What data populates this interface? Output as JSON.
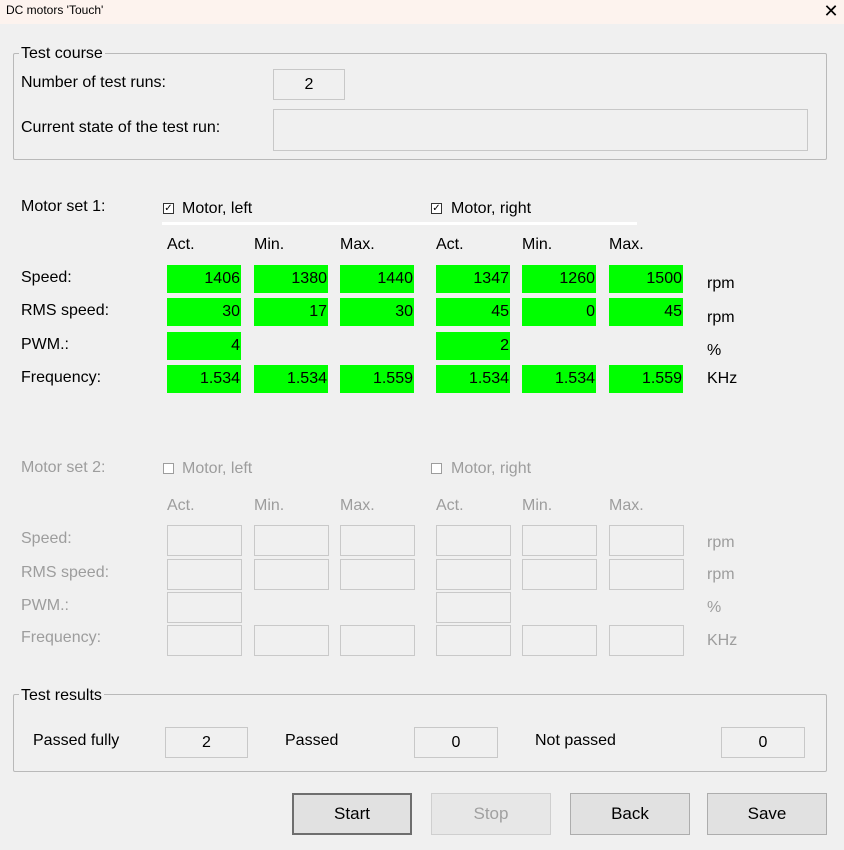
{
  "window": {
    "title": "DC motors 'Touch'"
  },
  "test_course": {
    "legend": "Test course",
    "num_runs_label": "Number of test runs:",
    "num_runs_value": "2",
    "state_label": "Current state of the test run:",
    "state_value": ""
  },
  "column_headers": [
    "Act.",
    "Min.",
    "Max.",
    "Act.",
    "Min.",
    "Max."
  ],
  "row_labels": [
    "Speed:",
    "RMS speed:",
    "PWM.:",
    "Frequency:"
  ],
  "units": [
    "rpm",
    "rpm",
    "%",
    "KHz"
  ],
  "motor_set_1": {
    "label": "Motor set 1:",
    "left_checkbox": {
      "label": "Motor, left",
      "checked": true
    },
    "right_checkbox": {
      "label": "Motor, right",
      "checked": true
    },
    "rows": [
      [
        "1406",
        "1380",
        "1440",
        "1347",
        "1260",
        "1500"
      ],
      [
        "30",
        "17",
        "30",
        "45",
        "0",
        "45"
      ],
      [
        "4",
        "",
        "",
        "2",
        "",
        ""
      ],
      [
        "1.534",
        "1.534",
        "1.559",
        "1.534",
        "1.534",
        "1.559"
      ]
    ]
  },
  "motor_set_2": {
    "label": "Motor set 2:",
    "left_checkbox": {
      "label": "Motor, left",
      "checked": false
    },
    "right_checkbox": {
      "label": "Motor, right",
      "checked": false
    }
  },
  "test_results": {
    "legend": "Test results",
    "passed_fully_label": "Passed fully",
    "passed_fully_value": "2",
    "passed_label": "Passed",
    "passed_value": "0",
    "not_passed_label": "Not passed",
    "not_passed_value": "0"
  },
  "buttons": {
    "start": "Start",
    "stop": "Stop",
    "back": "Back",
    "save": "Save"
  },
  "colors": {
    "ok": "#00ff00",
    "disabled_text": "#9d9d9d"
  }
}
